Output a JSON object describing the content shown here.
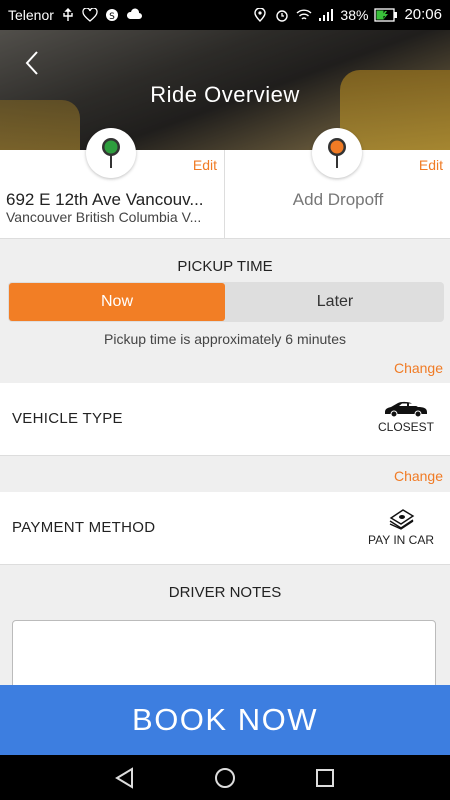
{
  "status_bar": {
    "carrier": "Telenor",
    "battery": "38%",
    "time": "20:06"
  },
  "header": {
    "title": "Ride Overview"
  },
  "pickup_location": {
    "edit_label": "Edit",
    "address_main": "692 E 12th Ave Vancouv...",
    "address_sub": "Vancouver British Columbia V...",
    "pin_color": "#2e9e3e"
  },
  "dropoff_location": {
    "edit_label": "Edit",
    "placeholder": "Add Dropoff",
    "pin_color": "#f07b25"
  },
  "pickup_time": {
    "title": "PICKUP TIME",
    "options": [
      "Now",
      "Later"
    ],
    "selected": "Now",
    "note": "Pickup time is approximately 6 minutes",
    "change_label": "Change"
  },
  "vehicle": {
    "label": "VEHICLE TYPE",
    "value": "CLOSEST",
    "icon": "car-icon"
  },
  "payment": {
    "change_label": "Change",
    "label": "PAYMENT METHOD",
    "value": "PAY IN CAR",
    "icon": "cash-icon"
  },
  "driver_notes": {
    "title": "DRIVER NOTES"
  },
  "book_button": {
    "label": "BOOK NOW",
    "color": "#3d7ee0"
  },
  "accent_color": "#f07b25"
}
